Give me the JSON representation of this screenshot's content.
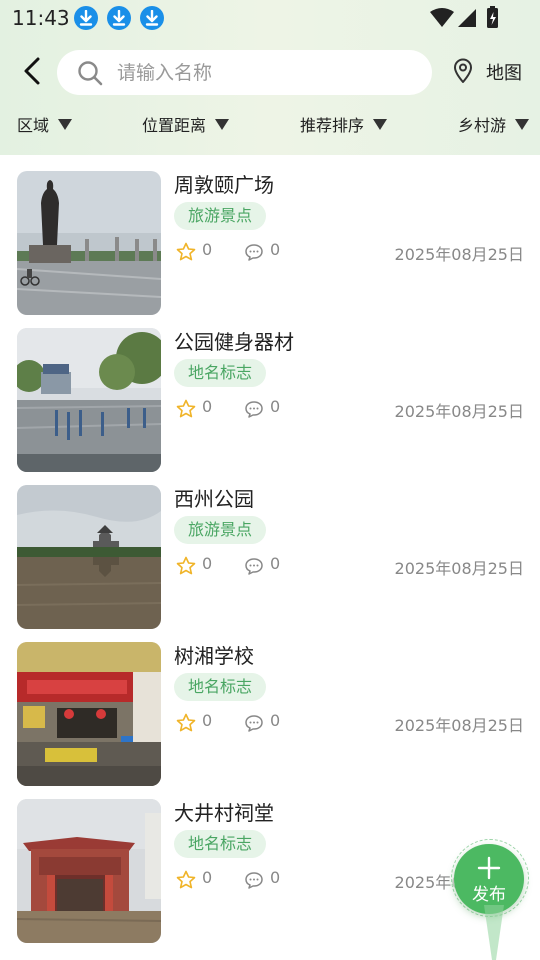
{
  "status_bar": {
    "time": "11:43",
    "notification_icons": [
      "download-icon",
      "download-icon",
      "download-icon"
    ],
    "system_icons": [
      "wifi-icon",
      "signal-icon",
      "battery-icon"
    ]
  },
  "search": {
    "placeholder": "请输入名称",
    "value": ""
  },
  "map_button": {
    "label": "地图"
  },
  "filters": [
    {
      "label": "区域"
    },
    {
      "label": "位置距离"
    },
    {
      "label": "推荐排序"
    },
    {
      "label": "乡村游"
    }
  ],
  "items": [
    {
      "title": "周敦颐广场",
      "tag": "旅游景点",
      "stars": "0",
      "comments": "0",
      "date": "2025年08月25日"
    },
    {
      "title": "公园健身器材",
      "tag": "地名标志",
      "stars": "0",
      "comments": "0",
      "date": "2025年08月25日"
    },
    {
      "title": "西州公园",
      "tag": "旅游景点",
      "stars": "0",
      "comments": "0",
      "date": "2025年08月25日"
    },
    {
      "title": "树湘学校",
      "tag": "地名标志",
      "stars": "0",
      "comments": "0",
      "date": "2025年08月25日"
    },
    {
      "title": "大井村祠堂",
      "tag": "地名标志",
      "stars": "0",
      "comments": "0",
      "date": "2025年08月25日"
    }
  ],
  "publish_button": {
    "label": "发布"
  },
  "colors": {
    "accent_green": "#4cb962",
    "tag_background": "#e6f4e8",
    "tag_text": "#4aa663",
    "star": "#f0b429",
    "notification_blue": "#1a8fe8"
  }
}
